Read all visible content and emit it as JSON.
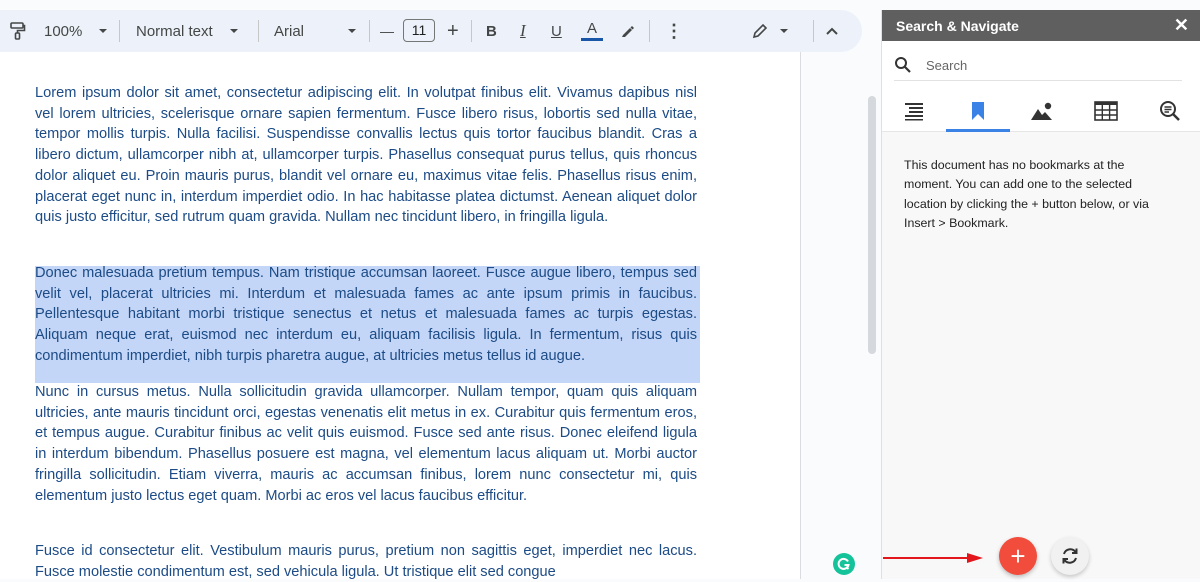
{
  "toolbar": {
    "paint_format_icon": "paint-roller-icon",
    "zoom": "100%",
    "style": "Normal text",
    "font": "Arial",
    "font_size": "11",
    "decrease_label": "—",
    "increase_label": "+",
    "bold": "B",
    "italic": "I",
    "underline": "U",
    "text_color": "A",
    "text_color_value": "#1a56a8",
    "more_label": "⋮",
    "collapse_label": "^"
  },
  "document": {
    "paragraphs": [
      "Lorem ipsum dolor sit amet, consectetur adipiscing elit. In volutpat finibus elit. Vivamus dapibus nisl vel lorem ultricies, scelerisque ornare sapien fermentum. Fusce libero risus, lobortis sed nulla vitae, tempor mollis turpis. Nulla facilisi. Suspendisse convallis lectus quis tortor faucibus blandit. Cras a libero dictum, ullamcorper nibh at, ullamcorper turpis. Phasellus consequat purus tellus, quis rhoncus dolor aliquet eu. Proin mauris purus, blandit vel ornare eu, maximus vitae felis. Phasellus risus enim, placerat eget nunc in, interdum imperdiet odio. In hac habitasse platea dictumst. Aenean aliquet dolor quis justo efficitur, sed rutrum quam gravida. Nullam nec tincidunt libero, in fringilla ligula.",
      "Donec malesuada pretium tempus. Nam tristique accumsan laoreet. Fusce augue libero, tempus sed velit vel, placerat ultricies mi. Interdum et malesuada fames ac ante ipsum primis in faucibus. Pellentesque habitant morbi tristique senectus et netus et malesuada fames ac turpis egestas. Aliquam neque erat, euismod nec interdum eu, aliquam facilisis ligula. In fermentum, risus quis condimentum imperdiet, nibh turpis pharetra augue, at ultricies metus tellus id augue.",
      "Nunc in cursus metus. Nulla sollicitudin gravida ullamcorper. Nullam tempor, quam quis aliquam ultricies, ante mauris tincidunt orci, egestas venenatis elit metus in ex. Curabitur quis fermentum eros, et tempus augue. Curabitur finibus ac velit quis euismod. Fusce sed ante risus. Donec eleifend ligula in interdum bibendum. Phasellus posuere est magna, vel elementum lacus aliquam ut. Morbi auctor fringilla sollicitudin. Etiam viverra, mauris ac accumsan finibus, lorem nunc consectetur mi, quis elementum justo lectus eget quam. Morbi ac eros vel lacus faucibus efficitur.",
      "Fusce id consectetur elit. Vestibulum mauris purus, pretium non sagittis eget, imperdiet nec lacus. Fusce molestie condimentum est, sed vehicula ligula. Ut tristique elit sed congue"
    ],
    "selected_paragraph_index": 1,
    "text_color": "#1c4b86",
    "selection_color": "#c3d6f7"
  },
  "panel": {
    "title": "Search & Navigate",
    "close_label": "✕",
    "search_placeholder": "Search",
    "tabs": [
      {
        "name": "headings",
        "icon": "headings-list-icon"
      },
      {
        "name": "bookmarks",
        "icon": "bookmark-icon",
        "active": true
      },
      {
        "name": "images",
        "icon": "image-icon"
      },
      {
        "name": "tables",
        "icon": "table-icon"
      },
      {
        "name": "find",
        "icon": "search-text-icon"
      }
    ],
    "empty_message": "This document has no bookmarks at the moment. You can add one to the selected location by clicking the + button below, or via Insert > Bookmark.",
    "add_button_label": "+",
    "accent_color": "#3b82e6",
    "add_color": "#f14c3c"
  }
}
